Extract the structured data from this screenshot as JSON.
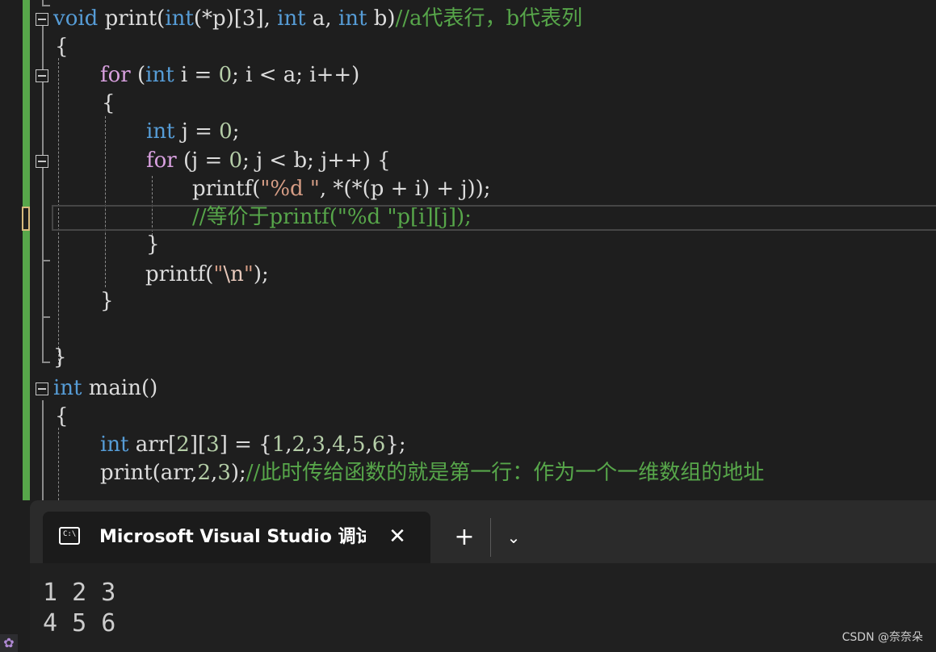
{
  "editor": {
    "line1": {
      "void": "void",
      "name": " print(",
      "int": "int",
      "mid": "(*p)[3], ",
      "int2": "int",
      "a": " a, ",
      "int3": "int",
      "b": " b)",
      "comment": "//a代表行，b代表列"
    },
    "line2": {
      "brace": "{"
    },
    "line3": {
      "for": "for",
      "p1": " (",
      "int": "int",
      "p2": " i = ",
      "zero": "0",
      "p3": "; i < a; i++)"
    },
    "line4": {
      "brace": "{"
    },
    "line5": {
      "int": "int",
      "p1": " j = ",
      "zero": "0",
      "p2": ";"
    },
    "line6": {
      "for": "for",
      "p1": " (j = ",
      "zero": "0",
      "p2": "; j < b; j++) {"
    },
    "line7": {
      "p1": "printf(",
      "str": "\"%d \"",
      "p2": ", *(*(p + i) + j));"
    },
    "line8": {
      "comment": "//等价于printf(\"%d \"p[i][j]);"
    },
    "line9": {
      "brace": "}"
    },
    "line10": {
      "p1": "printf(",
      "q1": "\"",
      "esc": "\\n",
      "q2": "\"",
      "p2": ");"
    },
    "line11": {
      "brace": "}"
    },
    "line12": {
      "brace": "}"
    },
    "line13": {
      "int": "int",
      "p1": " main()"
    },
    "line14": {
      "brace": "{"
    },
    "line15": {
      "int": "int",
      "p1": " arr[",
      "n2": "2",
      "p2": "][",
      "n3": "3",
      "p3": "] = {",
      "n1": "1",
      "c1": ",",
      "n2b": "2",
      "c2": ",",
      "n3b": "3",
      "c3": ",",
      "n4": "4",
      "c4": ",",
      "n5": "5",
      "c5": ",",
      "n6": "6",
      "p4": "};"
    },
    "line16": {
      "p1": "print(arr,",
      "n2": "2",
      "c1": ",",
      "n3": "3",
      "p2": ");",
      "comment": "//此时传给函数的就是第一行：作为一个一维数组的地址"
    }
  },
  "terminal": {
    "tab_icon_text": "C:\\",
    "tab_title": "Microsoft Visual Studio 调试控制台",
    "close_glyph": "✕",
    "new_tab_glyph": "+",
    "dropdown_glyph": "⌄",
    "output": [
      "1 2 3",
      "4 5 6"
    ]
  },
  "watermark": "CSDN @奈奈朵",
  "colors": {
    "accent_green": "#57a64a",
    "keyword": "#569cd6",
    "control": "#d8a0df",
    "string": "#d69d85",
    "number": "#b5cea8",
    "comment": "#57a64a"
  }
}
